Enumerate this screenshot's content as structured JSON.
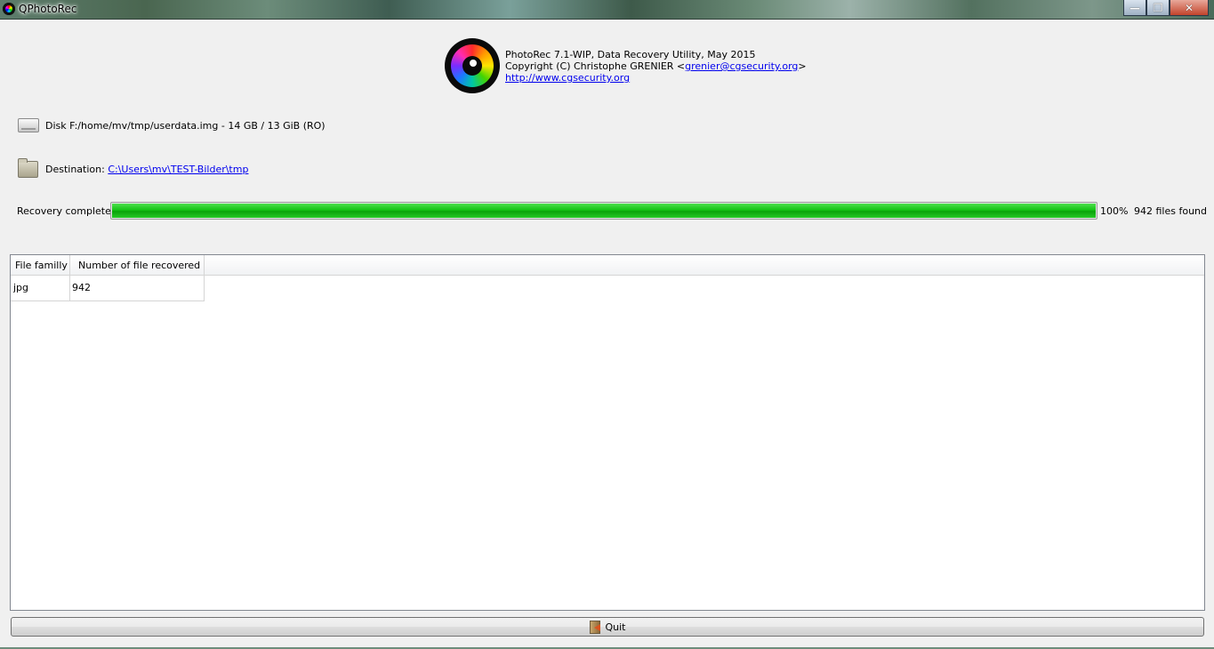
{
  "window": {
    "title": "QPhotoRec",
    "minimize_symbol": "—",
    "maximize_symbol": "❐",
    "close_symbol": "✕"
  },
  "header": {
    "line1": "PhotoRec 7.1-WIP, Data Recovery Utility, May 2015",
    "copyright_prefix": "Copyright (C) Christophe GRENIER <",
    "email": "grenier@cgsecurity.org",
    "copyright_suffix": ">",
    "website": "http://www.cgsecurity.org"
  },
  "disk": {
    "icon": "disk-icon",
    "text": "Disk F:/home/mv/tmp/userdata.img - 14 GB / 13 GiB (RO)"
  },
  "destination": {
    "icon": "folder-icon",
    "label": "Destination:",
    "path": "C:\\Users\\mv\\TEST-Bilder\\tmp"
  },
  "progress": {
    "status": "Recovery completed",
    "percent_label": "100%",
    "fraction": 1.0,
    "files_found": "942 files found",
    "bar_color": "#16c416"
  },
  "results_table": {
    "columns": [
      "File familly",
      "Number of file recovered"
    ],
    "rows": [
      [
        "jpg",
        "942"
      ]
    ]
  },
  "quit_button": {
    "icon": "exit-door-icon",
    "label": "Quit"
  }
}
